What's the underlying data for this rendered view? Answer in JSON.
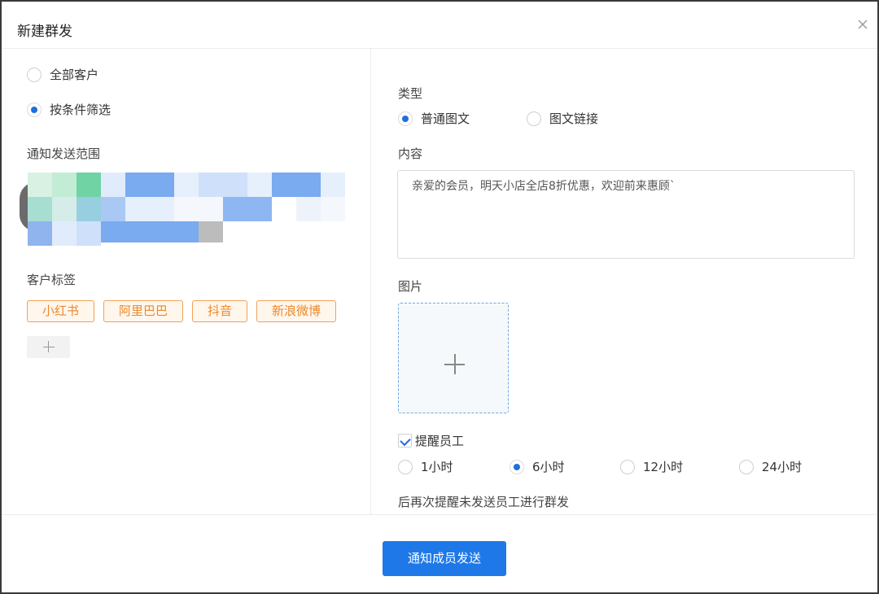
{
  "dialog": {
    "title": "新建群发",
    "close_icon": "close-icon"
  },
  "recipients": {
    "options": [
      {
        "label": "全部客户",
        "selected": false
      },
      {
        "label": "按条件筛选",
        "selected": true
      }
    ],
    "scope_label": "通知发送范围",
    "tags_label": "客户标签",
    "tags": [
      "小红书",
      "阿里巴巴",
      "抖音",
      "新浪微博"
    ],
    "add_tag_icon": "plus-icon"
  },
  "message": {
    "type_label": "类型",
    "type_options": [
      {
        "label": "普通图文",
        "selected": true
      },
      {
        "label": "图文链接",
        "selected": false
      }
    ],
    "content_label": "内容",
    "content_value": "亲爱的会员，明天小店全店8折优惠，欢迎前来惠顾`",
    "image_label": "图片",
    "upload_icon": "plus-icon"
  },
  "reminder": {
    "checkbox_label": "提醒员工",
    "checked": true,
    "interval_options": [
      {
        "label": "1小时",
        "selected": false
      },
      {
        "label": "6小时",
        "selected": true
      },
      {
        "label": "12小时",
        "selected": false
      },
      {
        "label": "24小时",
        "selected": false
      }
    ],
    "note": "后再次提醒未发送员工进行群发"
  },
  "footer": {
    "submit_label": "通知成员发送"
  },
  "colors": {
    "primary": "#1e78e8",
    "tag_border": "#f0a15a",
    "tag_text": "#ea8a2d"
  }
}
